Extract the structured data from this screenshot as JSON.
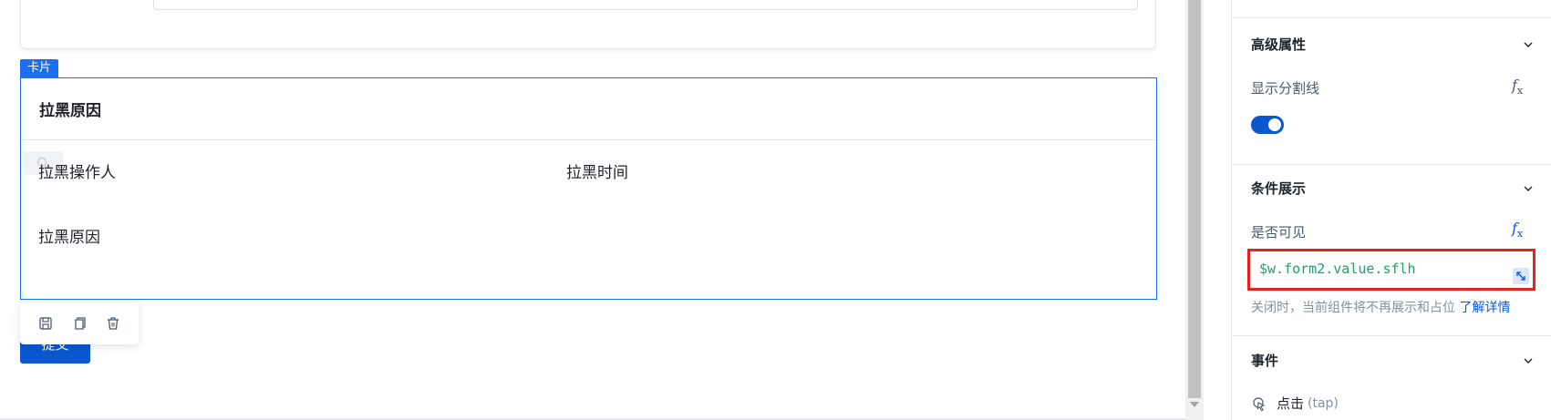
{
  "canvas": {
    "card": {
      "tag": "卡片",
      "title": "拉黑原因",
      "fields": [
        {
          "label": "拉黑操作人"
        },
        {
          "label": "拉黑时间"
        },
        {
          "label": "拉黑原因"
        }
      ]
    },
    "actions": [
      "save-icon",
      "copy-icon",
      "delete-icon"
    ],
    "submit_label": "提交"
  },
  "panel": {
    "advanced": {
      "title": "高级属性",
      "show_divider_label": "显示分割线",
      "show_divider_value": true
    },
    "condition": {
      "title": "条件展示",
      "visible_label": "是否可见",
      "expression": "$w.form2.value.sflh",
      "hint": "关闭时，当前组件将不再展示和占位",
      "learn_more": "了解详情"
    },
    "events": {
      "title": "事件",
      "item_label": "点击",
      "item_sub": "(tap)"
    },
    "fx_label": "f"
  },
  "colors": {
    "accent": "#0b57d0",
    "selection_border": "#1d6ff2",
    "highlight_red": "#e6231c",
    "expression_green": "#1ea362"
  }
}
